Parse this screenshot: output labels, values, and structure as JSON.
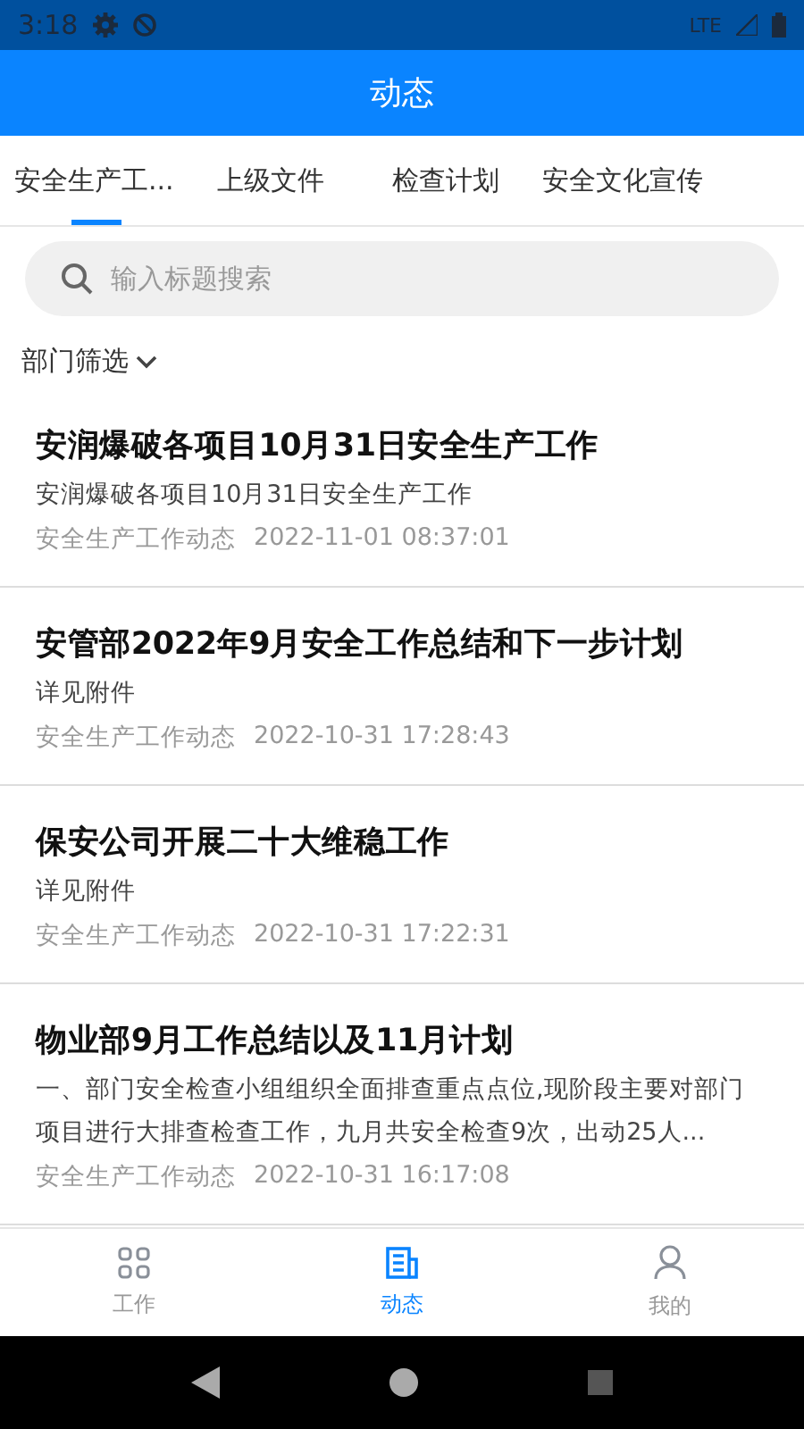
{
  "status_bar": {
    "time": "3:18",
    "network": "LTE"
  },
  "header": {
    "title": "动态"
  },
  "tabs": [
    {
      "label": "安全生产工...",
      "selected": true
    },
    {
      "label": "上级文件",
      "selected": false
    },
    {
      "label": "检查计划",
      "selected": false
    },
    {
      "label": "安全文化宣传",
      "selected": false
    }
  ],
  "search": {
    "placeholder": "输入标题搜索"
  },
  "filter": {
    "label": "部门筛选"
  },
  "articles": [
    {
      "title": "安润爆破各项目10月31日安全生产工作",
      "summary": "安润爆破各项目10月31日安全生产工作",
      "category": "安全生产工作动态",
      "time": "2022-11-01 08:37:01"
    },
    {
      "title": "安管部2022年9月安全工作总结和下一步计划",
      "summary": "详见附件",
      "category": "安全生产工作动态",
      "time": "2022-10-31 17:28:43"
    },
    {
      "title": "保安公司开展二十大维稳工作",
      "summary": "详见附件",
      "category": "安全生产工作动态",
      "time": "2022-10-31 17:22:31"
    },
    {
      "title": "物业部9月工作总结以及11月计划",
      "summary": "一、部门安全检查小组组织全面排查重点点位,现阶段主要对部门项目进行大排查检查工作，九月共安全检查9次，出动25人...",
      "category": "安全生产工作动态",
      "time": "2022-10-31 16:17:08"
    }
  ],
  "bottom_nav": [
    {
      "kind": "grid",
      "label": "工作",
      "selected": false
    },
    {
      "kind": "doc",
      "label": "动态",
      "selected": true
    },
    {
      "kind": "person",
      "label": "我的",
      "selected": false
    }
  ]
}
